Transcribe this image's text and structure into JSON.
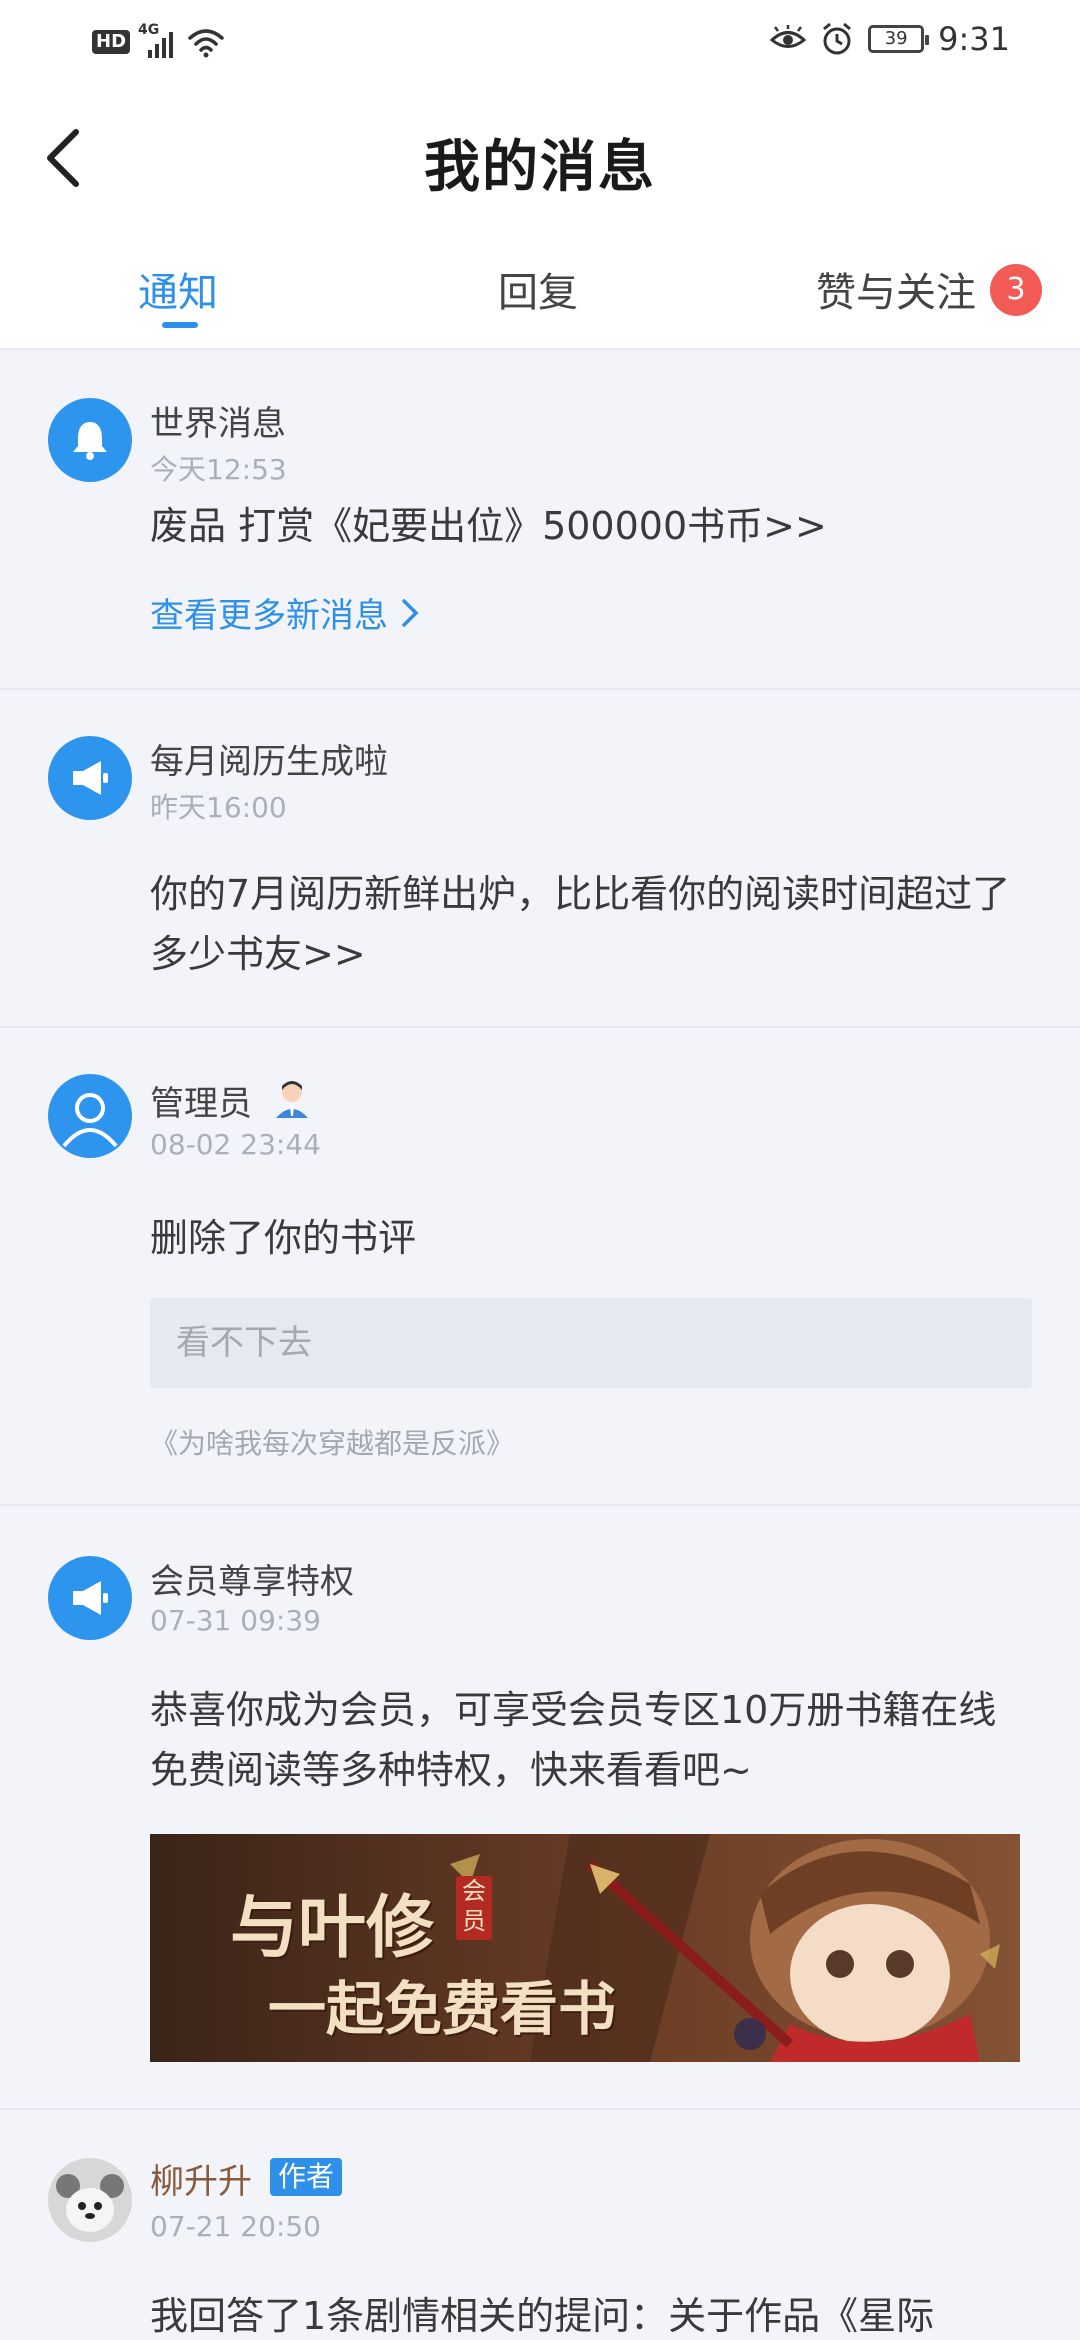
{
  "status_bar": {
    "network_badge": "HD",
    "signal_label": "4G",
    "battery_level": "39",
    "time": "9:31",
    "icons": [
      "eye-icon",
      "alarm-icon",
      "wifi-icon",
      "signal-icon",
      "battery-icon"
    ]
  },
  "header": {
    "title": "我的消息",
    "back_icon": "chevron-left-icon"
  },
  "tabs": {
    "items": [
      {
        "label": "通知",
        "active": true
      },
      {
        "label": "回复",
        "active": false
      },
      {
        "label": "赞与关注",
        "active": false,
        "badge": "3"
      }
    ]
  },
  "messages": [
    {
      "icon": "bell-icon",
      "name": "世界消息",
      "time": "今天12:53",
      "text": "废品 打赏《妃要出位》500000书币>>",
      "link": "查看更多新消息"
    },
    {
      "icon": "megaphone-icon",
      "name": "每月阅历生成啦",
      "time": "昨天16:00",
      "text": "你的7月阅历新鲜出炉，比比看你的阅读时间超过了多少书友>>"
    },
    {
      "icon": "person-icon",
      "name": "管理员",
      "time": "08-02 23:44",
      "text": "删除了你的书评",
      "quote": "看不下去",
      "book": "《为啥我每次穿越都是反派》"
    },
    {
      "icon": "megaphone-icon",
      "name": "会员尊享特权",
      "time": "07-31 09:39",
      "text": "恭喜你成为会员，可享受会员专区10万册书籍在线免费阅读等多种特权，快来看看吧~",
      "banner_line1": "与叶修",
      "banner_seal": "会员",
      "banner_line2": "一起免费看书"
    },
    {
      "name": "柳升升",
      "badge": "作者",
      "time": "07-21 20:50",
      "text": "我回答了1条剧情相关的提问：关于作品《星际"
    }
  ],
  "colors": {
    "accent": "#2e90e8",
    "badge": "#f25b55",
    "background": "#f2f4f9"
  }
}
